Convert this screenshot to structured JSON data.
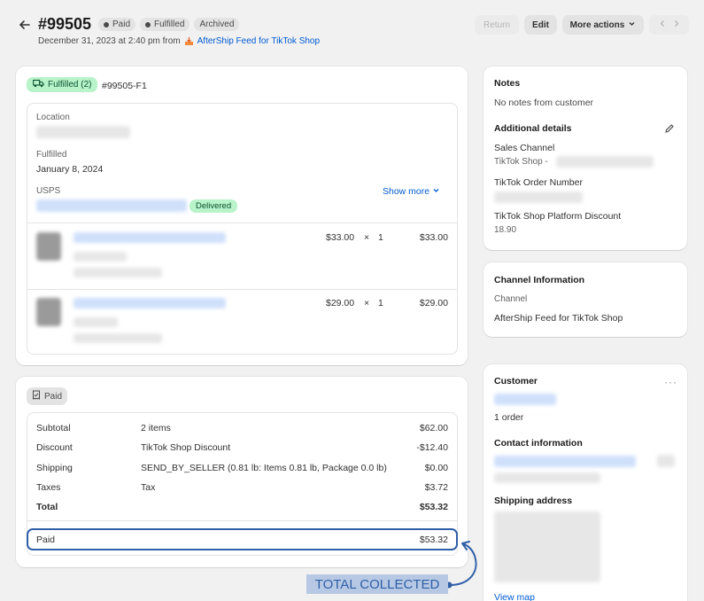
{
  "header": {
    "order_number": "#99505",
    "badges": [
      "Paid",
      "Fulfilled",
      "Archived"
    ],
    "date_text": "December 31, 2023 at 2:40 pm from",
    "source_link": "AfterShip Feed for TikTok Shop",
    "return_label": "Return",
    "edit_label": "Edit",
    "more_actions_label": "More actions"
  },
  "fulfillment": {
    "status_label": "Fulfilled (2)",
    "fulfillment_id": "#99505-F1",
    "location_label": "Location",
    "fulfilled_label": "Fulfilled",
    "fulfilled_date": "January 8, 2024",
    "carrier": "USPS",
    "delivered_label": "Delivered",
    "show_more_label": "Show more",
    "items": [
      {
        "price": "$33.00",
        "times": "×",
        "qty": "1",
        "total": "$33.00"
      },
      {
        "price": "$29.00",
        "times": "×",
        "qty": "1",
        "total": "$29.00"
      }
    ]
  },
  "payment": {
    "status_label": "Paid",
    "rows": [
      {
        "label": "Subtotal",
        "desc": "2 items",
        "amount": "$62.00"
      },
      {
        "label": "Discount",
        "desc": "TikTok Shop Discount",
        "amount": "-$12.40"
      },
      {
        "label": "Shipping",
        "desc": "SEND_BY_SELLER (0.81 lb: Items 0.81 lb, Package 0.0 lb)",
        "amount": "$0.00"
      },
      {
        "label": "Taxes",
        "desc": "Tax",
        "amount": "$3.72"
      }
    ],
    "total_label": "Total",
    "total_amount": "$53.32",
    "paid_label": "Paid",
    "paid_amount": "$53.32"
  },
  "annotation": {
    "text": "TOTAL COLLECTED",
    "color": "#2f5fa7"
  },
  "notes": {
    "title": "Notes",
    "text": "No notes from customer",
    "additional_title": "Additional details",
    "sales_channel_label": "Sales Channel",
    "sales_channel_value": "TikTok Shop -",
    "tiktok_order_label": "TikTok Order Number",
    "platform_discount_label": "TikTok Shop Platform Discount",
    "platform_discount_value": "18.90"
  },
  "channel": {
    "title": "Channel Information",
    "channel_label": "Channel",
    "channel_value": "AfterShip Feed for TikTok Shop"
  },
  "customer": {
    "title": "Customer",
    "orders_text": "1 order",
    "contact_title": "Contact information",
    "shipping_title": "Shipping address",
    "view_map_label": "View map"
  }
}
